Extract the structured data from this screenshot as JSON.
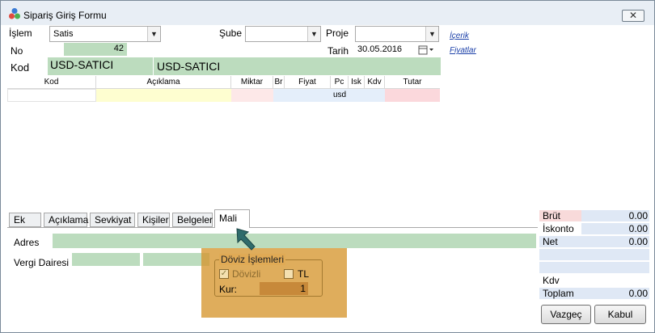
{
  "window": {
    "title": "Sipariş Giriş Formu",
    "close_glyph": "✕"
  },
  "form": {
    "islem_label": "İşlem",
    "islem_value": "Satis",
    "sube_label": "Şube",
    "sube_value": "",
    "proje_label": "Proje",
    "proje_value": "",
    "no_label": "No",
    "no_value": "42",
    "tarih_label": "Tarih",
    "tarih_value": "30.05.2016",
    "kod_label": "Kod",
    "kod_value": "USD-SATICI",
    "kod_desc": "USD-SATICI",
    "link_icerik": "İçerik",
    "link_fiyatlar": "Fiyatlar",
    "dropdown_glyph": "▼"
  },
  "grid": {
    "columns": [
      "Kod",
      "Açıklama",
      "Miktar",
      "Br",
      "Fiyat",
      "Pc",
      "Isk",
      "Kdv",
      "Tutar"
    ],
    "row": {
      "pc": "usd"
    }
  },
  "tabs": [
    "Ek",
    "Açıklama",
    "Sevkiyat",
    "Kişiler",
    "Belgeler",
    "Mali"
  ],
  "active_tab": "Mali",
  "mali": {
    "adres_label": "Adres",
    "vergi_label": "Vergi Dairesi",
    "doviz_title": "Döviz İşlemleri",
    "dovizli_label": "Dövizli",
    "tl_label": "TL",
    "kur_label": "Kur:",
    "kur_value": "1",
    "check_glyph": "✓"
  },
  "summary": {
    "brut_label": "Brüt",
    "brut_value": "0.00",
    "iskonto_label": "İskonto",
    "iskonto_value": "0.00",
    "net_label": "Net",
    "net_value": "0.00",
    "kdv_label": "Kdv",
    "kdv_value": "",
    "toplam_label": "Toplam",
    "toplam_value": "0.00"
  },
  "buttons": {
    "vazgec": "Vazgeç",
    "kabul": "Kabul"
  },
  "colors": {
    "green_field": "#bcdcbe",
    "highlight": "#d6962e",
    "pointer": "#2f6b6b"
  }
}
